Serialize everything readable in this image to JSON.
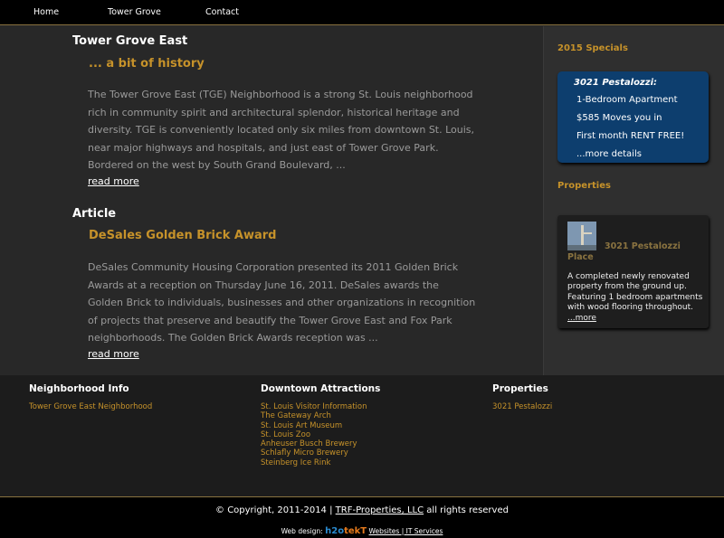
{
  "nav": {
    "items": [
      {
        "label": "Home"
      },
      {
        "label": "Tower Grove"
      },
      {
        "label": "Contact"
      }
    ]
  },
  "main": {
    "section1": {
      "title": "Tower Grove East",
      "subtitle": "... a bit of history",
      "body": "The Tower Grove East (TGE) Neighborhood is a strong St. Louis neighborhood rich in community spirit and architectural splendor, historical heritage and diversity. TGE is conveniently located only six miles from downtown St. Louis, near major highways and hospitals, and just east of Tower Grove Park. Bordered on the west by South Grand Boulevard, ...",
      "read_more": "read more"
    },
    "section2": {
      "title": "Article",
      "subtitle": "DeSales Golden Brick Award",
      "body": "DeSales Community Housing Corporation presented its 2011 Golden Brick Awards at a reception on Thursday June 16, 2011. DeSales awards the Golden Brick to individuals, businesses and other organizations in recognition of projects that preserve and beautify the Tower Grove East and Fox Park neighborhoods. The Golden Brick Awards reception was ...",
      "read_more": "read more"
    }
  },
  "sidebar": {
    "specials_heading": "2015 Specials",
    "special": {
      "title": "3021 Pestalozzi:",
      "line1": "1-Bedroom Apartment",
      "line2": "$585 Moves you in",
      "line3": "First month RENT FREE!",
      "more": "...more details"
    },
    "properties_heading": "Properties",
    "property": {
      "name_part1": "3021 Pestalozzi",
      "name_part2": "Place",
      "description": "A completed newly renovated property from the ground up. Featuring 1 bedroom apartments with wood flooring throughout.",
      "more": "...more"
    }
  },
  "footer": {
    "col1": {
      "heading": "Neighborhood Info",
      "links": [
        "Tower Grove East Neighborhood"
      ]
    },
    "col2": {
      "heading": "Downtown Attractions",
      "links": [
        "St. Louis Visitor Information",
        "The Gateway Arch",
        "St. Louis Art Museum",
        "St. Louis Zoo",
        "Anheuser Busch Brewery",
        "Schlafly Micro Brewery",
        "Steinberg Ice Rink"
      ]
    },
    "col3": {
      "heading": "Properties",
      "links": [
        "3021 Pestalozzi"
      ]
    },
    "copyright_prefix": "© Copyright, 2011-2014 |",
    "copyright_link": "TRF-Properties, LLC",
    "copyright_suffix": "all rights reserved",
    "credit_prefix": "Web design:",
    "logo_part1": "h2o",
    "logo_part2": "tekT",
    "credit_link": "Websites | IT Services"
  }
}
